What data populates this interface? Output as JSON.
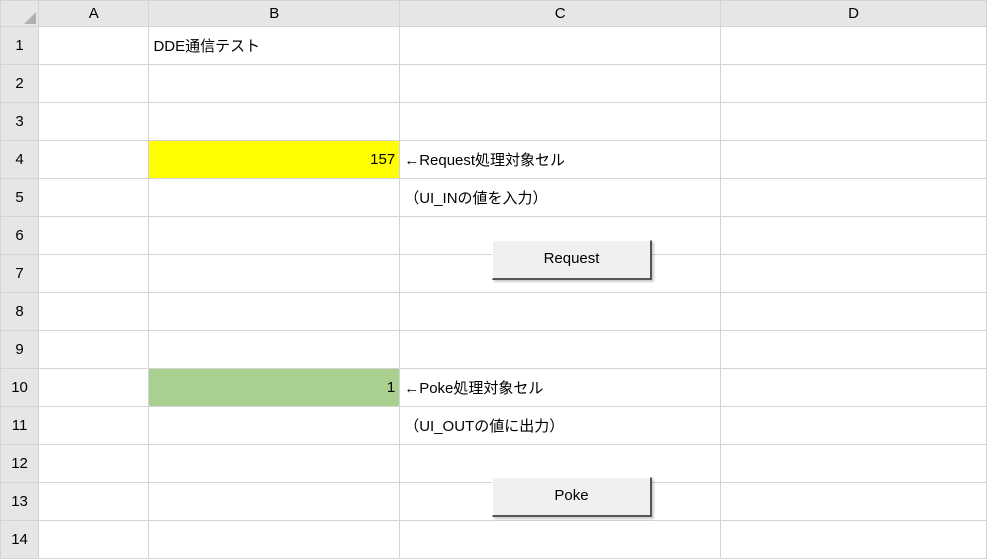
{
  "columns": [
    "A",
    "B",
    "C",
    "D"
  ],
  "rows": [
    1,
    2,
    3,
    4,
    5,
    6,
    7,
    8,
    9,
    10,
    11,
    12,
    13,
    14
  ],
  "cells": {
    "B1": "DDE通信テスト",
    "B4": "157",
    "C4": "←Request処理対象セル",
    "C5": "（UI_INの値を入力）",
    "B10": "1",
    "C10": "←Poke処理対象セル",
    "C11": "（UI_OUTの値に出力）"
  },
  "buttons": {
    "request_label": "Request",
    "poke_label": "Poke"
  },
  "highlights": {
    "B4_color": "#ffff00",
    "B10_color": "#a9d08e"
  }
}
